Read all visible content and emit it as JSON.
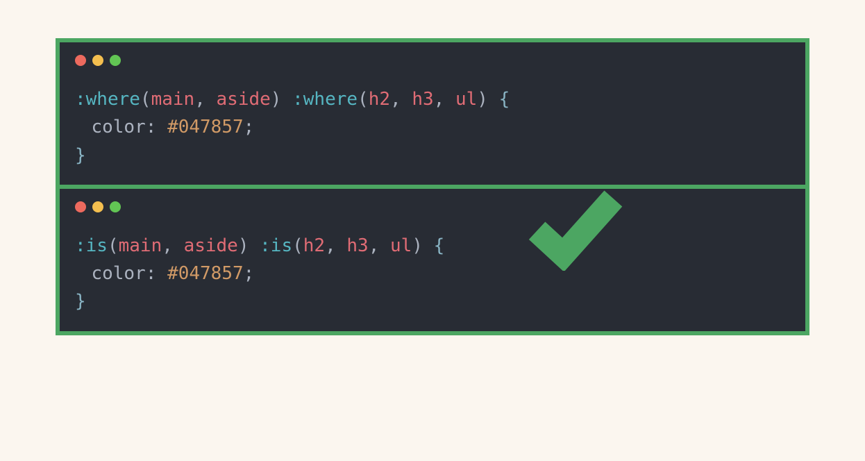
{
  "panels": [
    {
      "tokens": {
        "p1": ":where",
        "o1": "(",
        "a1": "main",
        "c1": ", ",
        "a2": "aside",
        "cl1": ")",
        "sp1": " ",
        "p2": ":where",
        "o2": "(",
        "a3": "h2",
        "c2": ", ",
        "a4": "h3",
        "c3": ", ",
        "a5": "ul",
        "cl2": ")",
        "sp2": " ",
        "obr": "{",
        "prop": "color",
        "colon": ": ",
        "val": "#047857",
        "semi": ";",
        "cbr": "}"
      }
    },
    {
      "tokens": {
        "p1": ":is",
        "o1": "(",
        "a1": "main",
        "c1": ", ",
        "a2": "aside",
        "cl1": ")",
        "sp1": " ",
        "p2": ":is",
        "o2": "(",
        "a3": "h2",
        "c2": ", ",
        "a4": "h3",
        "c3": ", ",
        "a5": "ul",
        "cl2": ")",
        "sp2": " ",
        "obr": "{",
        "prop": "color",
        "colon": ": ",
        "val": "#047857",
        "semi": ";",
        "cbr": "}"
      }
    }
  ],
  "colors": {
    "frameBorder": "#4ca662",
    "background": "#fbf6ef",
    "editorBg": "#282c34",
    "check": "#4ca662"
  }
}
